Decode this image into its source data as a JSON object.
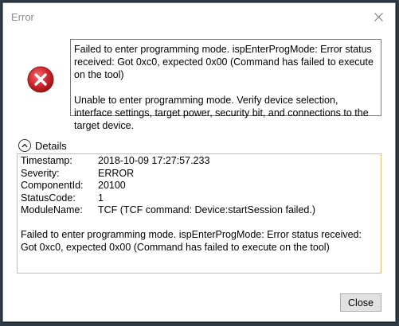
{
  "window": {
    "title": "Error",
    "close_icon": "close-icon"
  },
  "icon": {
    "name": "error-icon",
    "color": "#d0262d"
  },
  "message": {
    "paragraph1": "Failed to enter programming mode. ispEnterProgMode: Error status received: Got 0xc0, expected 0x00 (Command has failed to execute on the tool)",
    "paragraph2": "Unable to enter programming mode. Verify device selection, interface settings, target power, security bit, and connections to the target device."
  },
  "details": {
    "toggle_label": "Details",
    "toggle_icon": "chevron-up-circle-icon",
    "fields": [
      {
        "key": "Timestamp:",
        "value": "2018-10-09 17:27:57.233"
      },
      {
        "key": "Severity:",
        "value": "ERROR"
      },
      {
        "key": "ComponentId:",
        "value": "20100"
      },
      {
        "key": "StatusCode:",
        "value": "1"
      },
      {
        "key": "ModuleName:",
        "value": "TCF (TCF command: Device:startSession failed.)"
      }
    ],
    "message": "Failed to enter programming mode. ispEnterProgMode: Error status received: Got 0xc0, expected 0x00 (Command has failed to execute on the tool)",
    "border_color": "#d4c27a"
  },
  "buttons": {
    "close_label": "Close"
  }
}
